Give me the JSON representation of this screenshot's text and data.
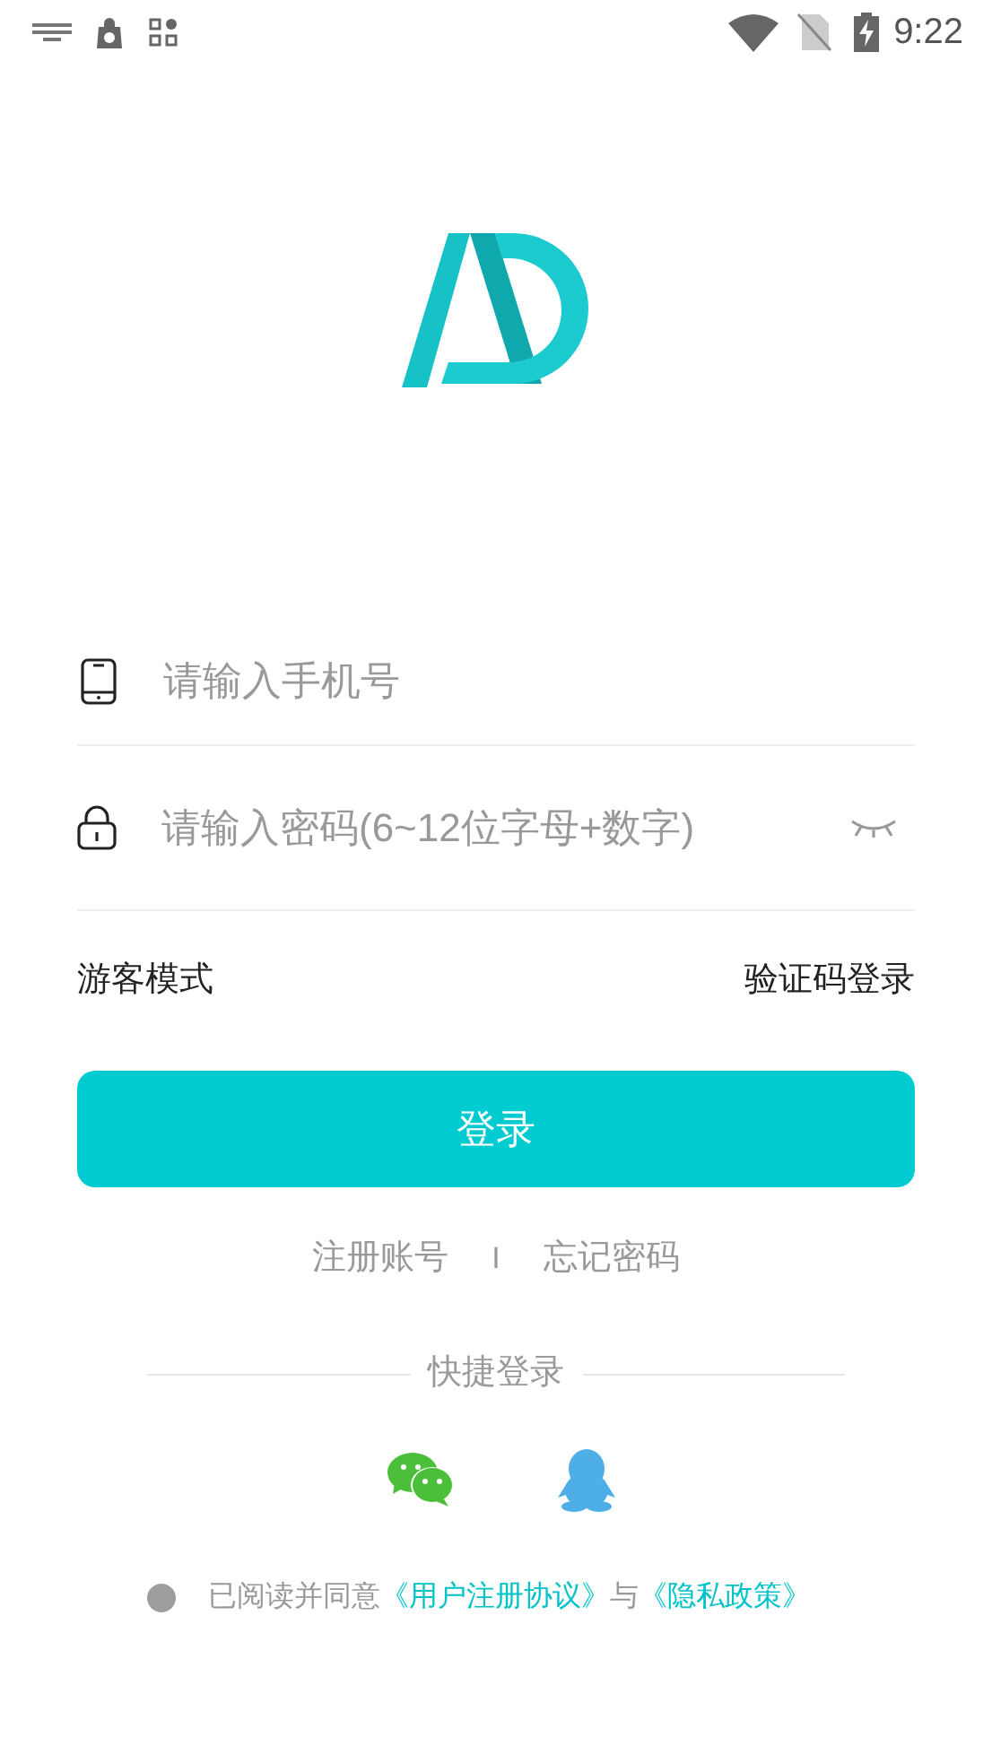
{
  "status_bar": {
    "time": "9:22"
  },
  "login_form": {
    "phone_field": {
      "placeholder": "请输入手机号"
    },
    "password_field": {
      "placeholder": "请输入密码(6~12位字母+数字)"
    }
  },
  "options": {
    "guest_mode": "游客模式",
    "sms_login": "验证码登录"
  },
  "login_button": "登录",
  "links": [
    {
      "label": "注册账号"
    },
    {
      "label": "忘记密码"
    }
  ],
  "link_separator": "I",
  "quick_login": {
    "title": "快捷登录"
  },
  "agreement": {
    "checked": false,
    "prefix": "已阅读并同意",
    "user_agreement": "《用户注册协议》",
    "conjunction": "与",
    "privacy_policy": "《隐私政策》"
  }
}
